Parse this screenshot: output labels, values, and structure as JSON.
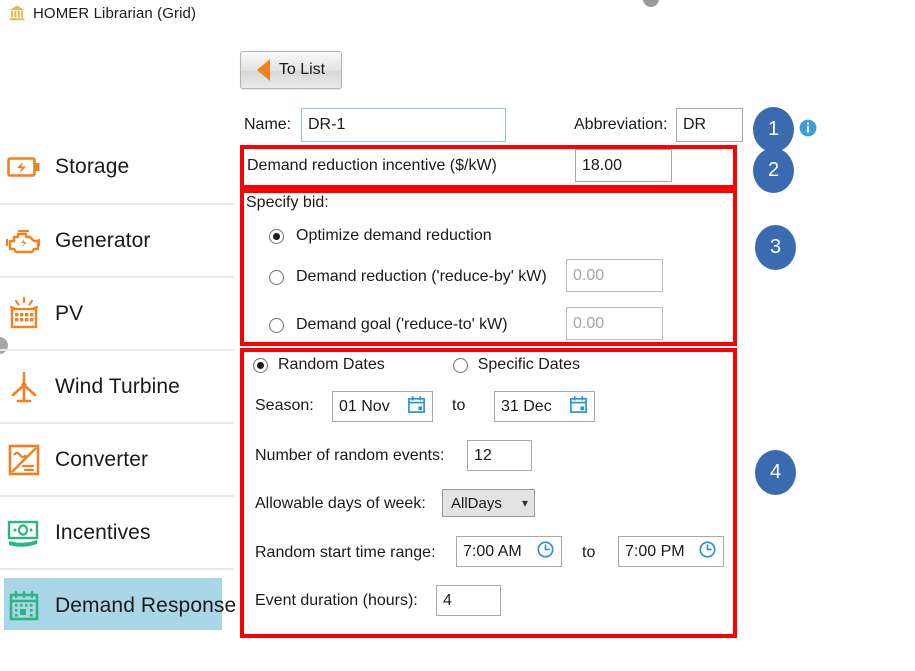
{
  "window": {
    "title": "HOMER Librarian (Grid)",
    "title_icon": "bank-icon"
  },
  "toolbar": {
    "to_list_label": "To List",
    "to_list_icon": "triangle-left-icon"
  },
  "sidebar": {
    "items": [
      {
        "label": "Storage",
        "icon": "battery-icon",
        "color": "#f08020",
        "selected": false
      },
      {
        "label": "Generator",
        "icon": "engine-icon",
        "color": "#f08020",
        "selected": false
      },
      {
        "label": "PV",
        "icon": "solar-panel-icon",
        "color": "#f08020",
        "selected": false
      },
      {
        "label": "Wind Turbine",
        "icon": "wind-turbine-icon",
        "color": "#f08020",
        "selected": false
      },
      {
        "label": "Converter",
        "icon": "converter-icon",
        "color": "#f08020",
        "selected": false
      },
      {
        "label": "Incentives",
        "icon": "banknote-icon",
        "color": "#2cb67d",
        "selected": false
      },
      {
        "label": "Demand Response",
        "icon": "calendar-grid-icon",
        "color": "#2cb67d",
        "selected": true
      }
    ]
  },
  "form": {
    "name_label": "Name:",
    "name_value": "DR-1",
    "abbreviation_label": "Abbreviation:",
    "abbreviation_value": "DR",
    "info_icon": "info-icon"
  },
  "incentive": {
    "label": "Demand reduction incentive ($/kW)",
    "value": "18.00"
  },
  "bid": {
    "title": "Specify bid:",
    "options": [
      {
        "label": "Optimize demand reduction",
        "selected": true,
        "value": null
      },
      {
        "label": "Demand reduction ('reduce-by' kW)",
        "selected": false,
        "value": "0.00"
      },
      {
        "label": "Demand goal ('reduce-to' kW)",
        "selected": false,
        "value": "0.00"
      }
    ]
  },
  "schedule": {
    "mode_options": [
      {
        "label": "Random Dates",
        "selected": true
      },
      {
        "label": "Specific Dates",
        "selected": false
      }
    ],
    "season_label": "Season:",
    "season_from": "01 Nov",
    "season_to": "31 Dec",
    "to_label": "to",
    "calendar_icon": "calendar-icon",
    "num_events_label": "Number of random events:",
    "num_events_value": "12",
    "days_of_week_label": "Allowable days of week:",
    "days_of_week_value": "AllDays",
    "days_of_week_caret": "chevron-down-icon",
    "start_time_label": "Random start time range:",
    "start_time_from": "7:00 AM",
    "start_time_to": "7:00 PM",
    "clock_icon": "clock-icon",
    "duration_label": "Event duration (hours):",
    "duration_value": "4"
  },
  "annotations": {
    "badges": [
      "1",
      "2",
      "3",
      "4"
    ],
    "box_color": "#ff0000",
    "badge_color": "#3a6ab0"
  }
}
